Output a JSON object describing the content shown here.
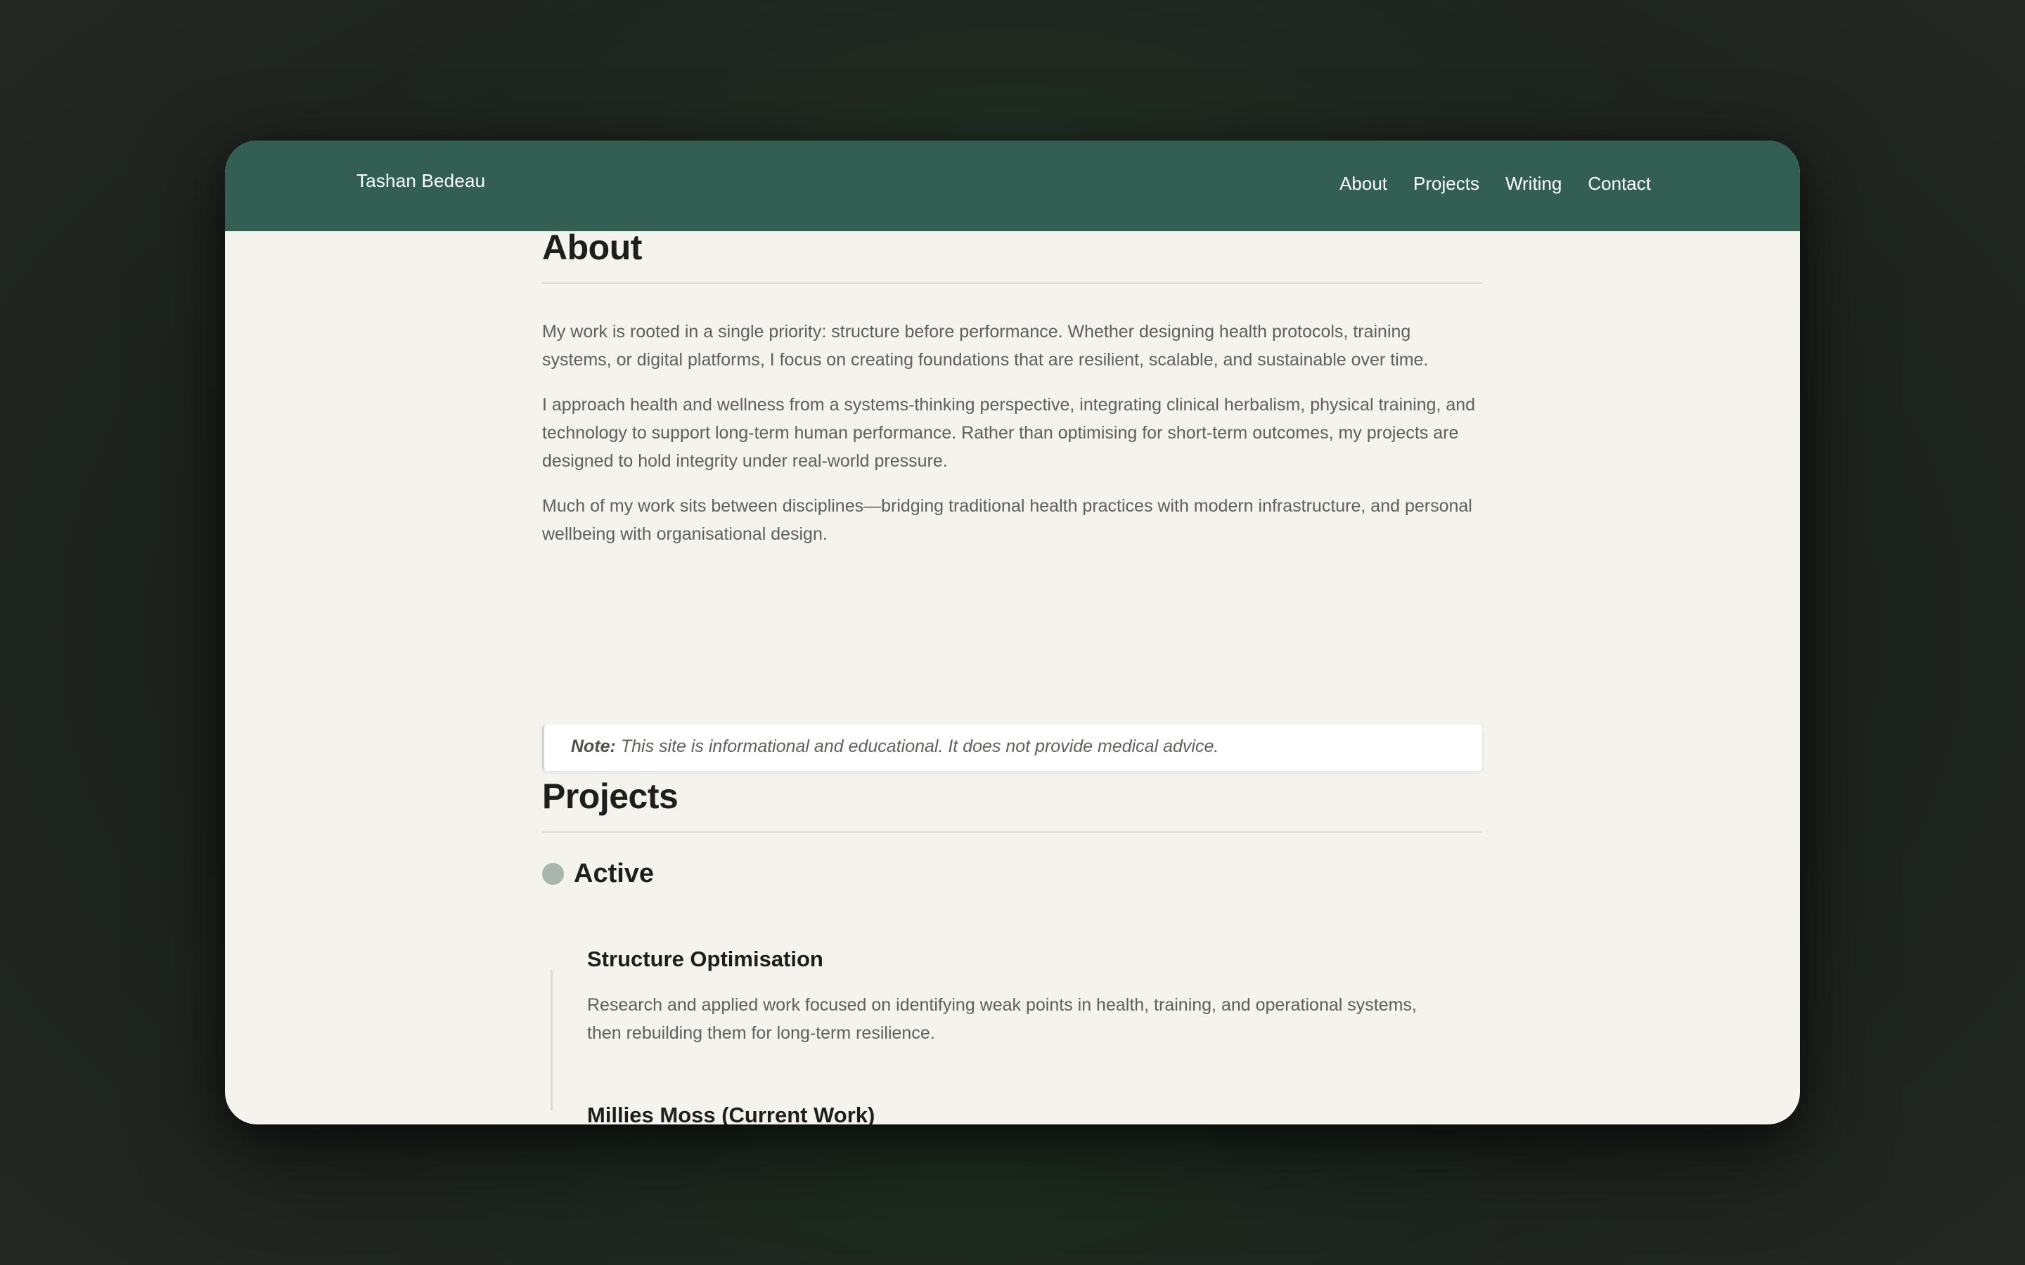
{
  "site": {
    "brand": "Tashan Bedeau",
    "nav": [
      "About",
      "Projects",
      "Writing",
      "Contact"
    ]
  },
  "about": {
    "title": "About",
    "paragraphs": [
      "My work is rooted in a single priority: structure before performance. Whether designing health protocols, training systems, or digital platforms, I focus on creating foundations that are resilient, scalable, and sustainable over time.",
      "I approach health and wellness from a systems-thinking perspective, integrating clinical herbalism, physical training, and technology to support long-term human performance. Rather than optimising for short-term outcomes, my projects are designed to hold integrity under real-world pressure.",
      "Much of my work sits between disciplines—bridging traditional health practices with modern infrastructure, and personal wellbeing with organisational design."
    ],
    "note_label": "Note:",
    "note_text": " This site is informational and educational. It does not provide medical advice."
  },
  "projects": {
    "title": "Projects",
    "status_label": "Active",
    "items": [
      {
        "title": "Structure Optimisation",
        "description": "Research and applied work focused on identifying weak points in health, training, and operational systems, then rebuilding them for long-term resilience."
      },
      {
        "title": "Millies Moss (Current Work)",
        "description": ""
      }
    ]
  },
  "colors": {
    "navbar": "#325f51",
    "page_background": "#f4f3ed",
    "status_dot": "#a9b6ad"
  }
}
